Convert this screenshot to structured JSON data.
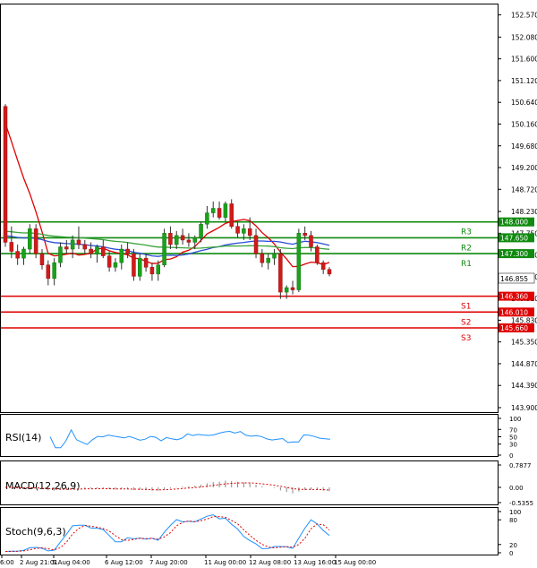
{
  "chart_data": {
    "type": "candlestick",
    "price_axis": {
      "min": 143.9,
      "max": 152.8,
      "ticks": [
        "152.570",
        "152.080",
        "151.600",
        "151.120",
        "150.640",
        "150.160",
        "149.680",
        "149.200",
        "148.720",
        "148.230",
        "147.750",
        "147.270",
        "146.790",
        "146.310",
        "145.830",
        "145.350",
        "144.870",
        "144.390",
        "143.900"
      ]
    },
    "last_price": "146.855",
    "levels": [
      {
        "name": "R3",
        "value": 148.0,
        "label": "148.000",
        "color": "#0f8a0f"
      },
      {
        "name": "R2",
        "value": 147.65,
        "label": "147.650",
        "color": "#0f8a0f"
      },
      {
        "name": "R1",
        "value": 147.3,
        "label": "147.300",
        "color": "#0f8a0f"
      },
      {
        "name": "S1",
        "value": 146.36,
        "label": "146.360",
        "color": "#e00000"
      },
      {
        "name": "S2",
        "value": 146.01,
        "label": "146.010",
        "color": "#e00000"
      },
      {
        "name": "S3",
        "value": 145.66,
        "label": "145.660",
        "color": "#e00000"
      }
    ],
    "time_labels": [
      "6:00",
      "2 Aug 21:01",
      "5 Aug 04:00",
      "6 Aug 12:00",
      "7 Aug 20:00",
      "11 Aug 00:00",
      "12 Aug 08:00",
      "13 Aug 16:00",
      "15 Aug 00:00"
    ],
    "candles": [
      [
        150.55,
        150.6,
        147.45,
        147.55
      ],
      [
        147.55,
        147.9,
        147.2,
        147.35
      ],
      [
        147.35,
        147.5,
        147.05,
        147.2
      ],
      [
        147.2,
        147.45,
        147.05,
        147.4
      ],
      [
        147.4,
        147.95,
        147.3,
        147.85
      ],
      [
        147.85,
        147.95,
        147.2,
        147.3
      ],
      [
        147.3,
        147.4,
        146.95,
        147.05
      ],
      [
        147.05,
        147.15,
        146.6,
        146.75
      ],
      [
        146.75,
        147.2,
        146.6,
        147.1
      ],
      [
        147.1,
        147.55,
        147.0,
        147.45
      ],
      [
        147.45,
        147.6,
        147.3,
        147.4
      ],
      [
        147.4,
        147.7,
        147.2,
        147.6
      ],
      [
        147.6,
        147.9,
        147.4,
        147.5
      ],
      [
        147.5,
        147.6,
        147.3,
        147.4
      ],
      [
        147.4,
        147.55,
        147.2,
        147.3
      ],
      [
        147.3,
        147.5,
        147.1,
        147.45
      ],
      [
        147.45,
        147.6,
        147.2,
        147.25
      ],
      [
        147.25,
        147.35,
        146.9,
        147.0
      ],
      [
        147.0,
        147.2,
        146.9,
        147.1
      ],
      [
        147.1,
        147.5,
        146.95,
        147.4
      ],
      [
        147.4,
        147.55,
        147.2,
        147.3
      ],
      [
        147.3,
        147.4,
        146.7,
        146.8
      ],
      [
        146.8,
        147.3,
        146.7,
        147.2
      ],
      [
        147.2,
        147.3,
        146.9,
        147.0
      ],
      [
        147.0,
        147.1,
        146.7,
        146.85
      ],
      [
        146.85,
        147.15,
        146.7,
        147.05
      ],
      [
        147.05,
        147.85,
        147.0,
        147.75
      ],
      [
        147.75,
        147.9,
        147.4,
        147.5
      ],
      [
        147.5,
        147.8,
        147.4,
        147.7
      ],
      [
        147.7,
        147.85,
        147.5,
        147.6
      ],
      [
        147.6,
        147.75,
        147.45,
        147.55
      ],
      [
        147.55,
        147.7,
        147.4,
        147.65
      ],
      [
        147.65,
        148.0,
        147.55,
        147.95
      ],
      [
        147.95,
        148.35,
        147.85,
        148.2
      ],
      [
        148.2,
        148.45,
        148.1,
        148.3
      ],
      [
        148.3,
        148.45,
        148.05,
        148.1
      ],
      [
        148.1,
        148.45,
        148.0,
        148.4
      ],
      [
        148.4,
        148.5,
        147.85,
        147.9
      ],
      [
        147.9,
        148.0,
        147.65,
        147.75
      ],
      [
        147.75,
        147.95,
        147.6,
        147.85
      ],
      [
        147.85,
        148.1,
        147.6,
        147.7
      ],
      [
        147.7,
        147.85,
        147.2,
        147.3
      ],
      [
        147.3,
        147.4,
        147.0,
        147.1
      ],
      [
        147.1,
        147.3,
        146.95,
        147.2
      ],
      [
        147.2,
        147.4,
        147.05,
        147.3
      ],
      [
        147.3,
        147.4,
        146.3,
        146.45
      ],
      [
        146.45,
        146.6,
        146.3,
        146.55
      ],
      [
        146.55,
        146.7,
        146.4,
        146.5
      ],
      [
        146.5,
        147.85,
        146.45,
        147.75
      ],
      [
        147.75,
        147.9,
        147.6,
        147.7
      ],
      [
        147.7,
        147.8,
        147.35,
        147.45
      ],
      [
        147.45,
        147.5,
        147.05,
        147.1
      ],
      [
        147.1,
        147.15,
        146.85,
        146.95
      ],
      [
        146.95,
        147.0,
        146.8,
        146.85
      ]
    ],
    "panels": [
      {
        "name": "RSI(14)",
        "ticks": [
          "100",
          "70",
          "50",
          "30",
          "0"
        ]
      },
      {
        "name": "MACD(12,26,9)",
        "ticks": [
          "0.7877",
          "0.00",
          "-0.5355"
        ]
      },
      {
        "name": "Stoch(9,6,3)",
        "ticks": [
          "100",
          "80",
          "20",
          "0"
        ]
      }
    ]
  }
}
